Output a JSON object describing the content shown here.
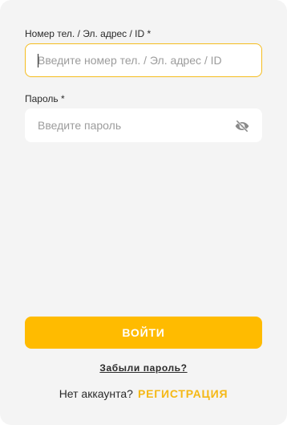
{
  "form": {
    "phone_label": "Номер тел. / Эл. адрес / ID *",
    "phone_placeholder": "Введите номер тел. / Эл. адрес / ID",
    "phone_value": "",
    "password_label": "Пароль *",
    "password_placeholder": "Введите пароль",
    "password_value": "",
    "password_toggle_icon": "eye-off-icon"
  },
  "actions": {
    "login_label": "ВОЙТИ",
    "forgot_label": "Забыли пароль?",
    "no_account_text": "Нет аккаунта?",
    "signup_label": "РЕГИСТРАЦИЯ"
  },
  "colors": {
    "accent": "#ffbb00",
    "panel_bg": "#f4f4f4",
    "input_focus_border": "#f5bd1f"
  }
}
